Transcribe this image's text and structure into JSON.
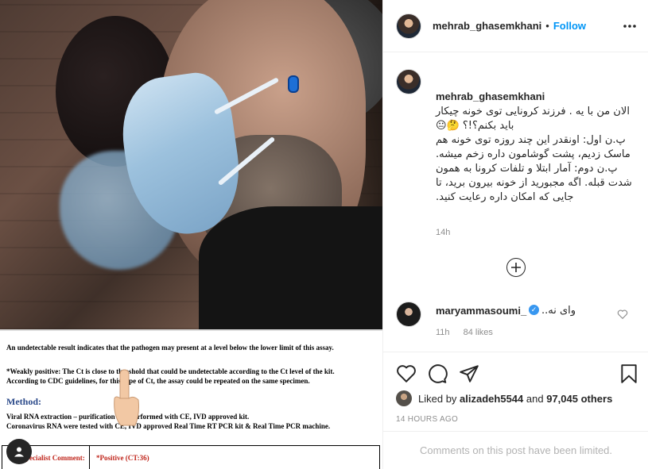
{
  "post": {
    "username": "mehrab_ghasemkhani",
    "follow_label": "Follow",
    "dot": "•",
    "caption": "الان من با یه . فرزند کرونایی توی خونه چیکار باید بکنم؟!؟ 🤔😐\nپ.ن اول: اونقدر این چند روزه توی خونه هم ماسک زدیم، پشت گوشامون داره زخم میشه.\nپ.ن دوم: آمار ابتلا و تلفات کرونا به همون شدت قبله. اگه مجبورید از خونه بیرون برید، تا جایی که امکان داره رعایت کنید.",
    "caption_time": "14h",
    "comment": {
      "username": "maryammasoumi_",
      "text": "وای نه..",
      "time": "11h",
      "likes": "84 likes"
    },
    "liked_by_prefix": "Liked by",
    "liked_by_user": "alizadeh5544",
    "liked_by_and": "and",
    "liked_by_others": "97,045 others",
    "time_ago": "14 HOURS AGO",
    "comments_limited": "Comments on this post have been limited."
  },
  "document": {
    "line1": "An undetectable result indicates that the pathogen may present at a level below the lower limit of this assay.",
    "line2": "*Weakly positive: The Ct is close to threshold that could be undetectable according to the Ct level of the kit.",
    "line3": "According to CDC guidelines, for this type of Ct, the assay could be repeated on the same specimen.",
    "method": "Method:",
    "line4": "Viral RNA extraction – purification was performed with CE, IVD approved kit.",
    "line5": "Coronavirus RNA were tested with CE, IVD approved Real Time RT PCR kit & Real Time PCR machine.",
    "cell_a": "Specialist Comment:",
    "cell_b": "*Positive (CT:36)"
  },
  "icons": {
    "more": "more-horizontal-icon",
    "heart": "heart-icon",
    "comment": "comment-icon",
    "share": "share-icon",
    "save": "bookmark-icon",
    "add": "plus-circle-icon",
    "profile": "user-icon",
    "verified": "verified-badge-icon",
    "finger": "pointing-hand-icon"
  },
  "colors": {
    "accent": "#0095f6",
    "muted": "#8e8e8e",
    "doc_red": "#c0261c"
  }
}
